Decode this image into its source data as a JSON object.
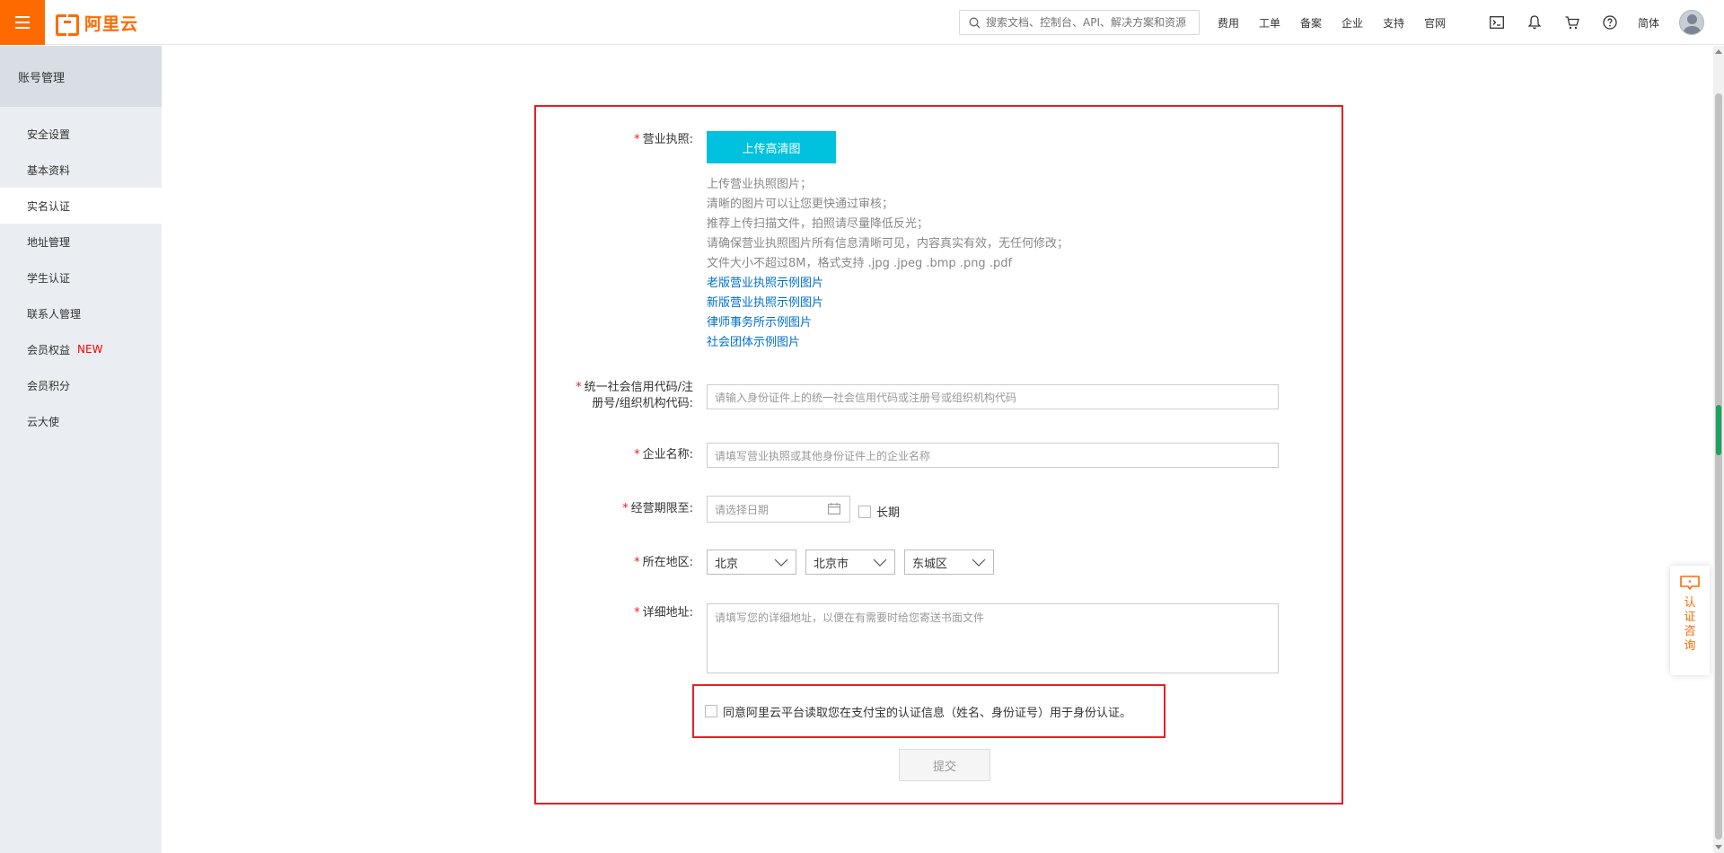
{
  "header": {
    "logo_text": "阿里云",
    "search_placeholder": "搜索文档、控制台、API、解决方案和资源",
    "nav": [
      "费用",
      "工单",
      "备案",
      "企业",
      "支持",
      "官网"
    ],
    "icons": [
      "terminal-icon",
      "bell-icon",
      "cart-icon",
      "help-icon"
    ],
    "lang": "简体",
    "brand_color": "#ff6a00"
  },
  "sidebar": {
    "title": "账号管理",
    "items": [
      {
        "label": "安全设置"
      },
      {
        "label": "基本资料"
      },
      {
        "label": "实名认证",
        "active": true
      },
      {
        "label": "地址管理"
      },
      {
        "label": "学生认证"
      },
      {
        "label": "联系人管理"
      },
      {
        "label": "会员权益",
        "badge": "NEW"
      },
      {
        "label": "会员积分"
      },
      {
        "label": "云大使"
      }
    ]
  },
  "form": {
    "license": {
      "label": "营业执照:",
      "upload_label": "上传高清图",
      "tips": [
        "上传营业执照图片；",
        "清晰的图片可以让您更快通过审核；",
        "推荐上传扫描文件，拍照请尽量降低反光；",
        "请确保营业执照图片所有信息清晰可见，内容真实有效，无任何修改；",
        "文件大小不超过8M，格式支持 .jpg .jpeg .bmp .png .pdf"
      ],
      "links": [
        "老版营业执照示例图片",
        "新版营业执照示例图片",
        "律师事务所示例图片",
        "社会团体示例图片"
      ]
    },
    "credit_code": {
      "label_line1": "统一社会信用代码/注",
      "label_line2": "册号/组织机构代码:",
      "placeholder": "请输入身份证件上的统一社会信用代码或注册号或组织机构代码"
    },
    "company_name": {
      "label": "企业名称:",
      "placeholder": "请填写营业执照或其他身份证件上的企业名称"
    },
    "term": {
      "label": "经营期限至:",
      "date_placeholder": "请选择日期",
      "long_term": "长期"
    },
    "region": {
      "label": "所在地区:",
      "province": "北京",
      "city": "北京市",
      "district": "东城区"
    },
    "address": {
      "label": "详细地址:",
      "placeholder": "请填写您的详细地址，以便在有需要时给您寄送书面文件"
    },
    "agree_text": "同意阿里云平台读取您在支付宝的认证信息（姓名、身份证号）用于身份认证。",
    "submit_label": "提交",
    "required_mark": "*"
  },
  "consult": {
    "text": "认证咨询"
  }
}
